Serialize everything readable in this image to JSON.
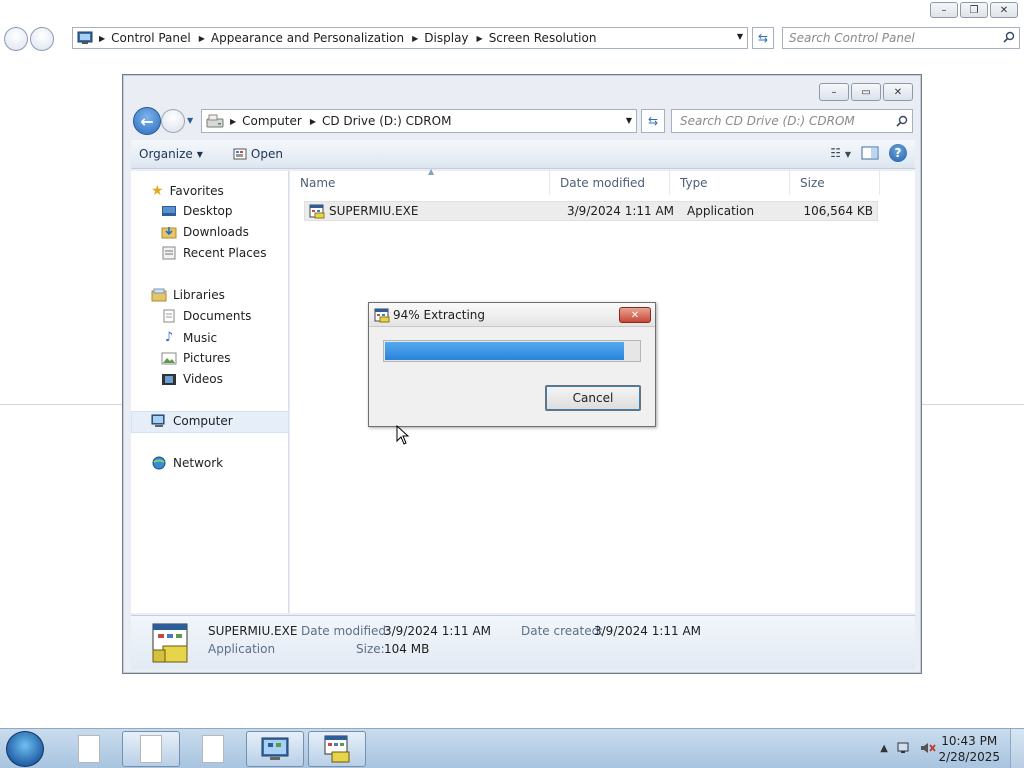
{
  "bg_window": {
    "breadcrumb": [
      "Control Panel",
      "Appearance and Personalization",
      "Display",
      "Screen Resolution"
    ],
    "search_placeholder": "Search Control Panel"
  },
  "explorer": {
    "breadcrumb": [
      "Computer",
      "CD Drive (D:) CDROM"
    ],
    "search_placeholder": "Search CD Drive (D:) CDROM",
    "toolbar": {
      "organize": "Organize",
      "open": "Open"
    },
    "nav": {
      "favorites": "Favorites",
      "favorites_items": [
        "Desktop",
        "Downloads",
        "Recent Places"
      ],
      "libraries": "Libraries",
      "libraries_items": [
        "Documents",
        "Music",
        "Pictures",
        "Videos"
      ],
      "computer": "Computer",
      "network": "Network"
    },
    "columns": [
      "Name",
      "Date modified",
      "Type",
      "Size"
    ],
    "files": [
      {
        "name": "SUPERMIU.EXE",
        "date": "3/9/2024 1:11 AM",
        "type": "Application",
        "size": "106,564 KB"
      }
    ],
    "details": {
      "name": "SUPERMIU.EXE",
      "type": "Application",
      "modified_label": "Date modified:",
      "modified_value": "3/9/2024 1:11 AM",
      "size_label": "Size:",
      "size_value": "104 MB",
      "created_label": "Date created:",
      "created_value": "3/9/2024 1:11 AM"
    }
  },
  "dialog": {
    "title": "94% Extracting",
    "progress_fraction": 0.94,
    "cancel_label": "Cancel"
  },
  "taskbar": {
    "time": "10:43 PM",
    "date": "2/28/2025"
  },
  "colors": {
    "progress": "#2884db",
    "selection": "#e5eef9",
    "close_red": "#c74a35"
  }
}
